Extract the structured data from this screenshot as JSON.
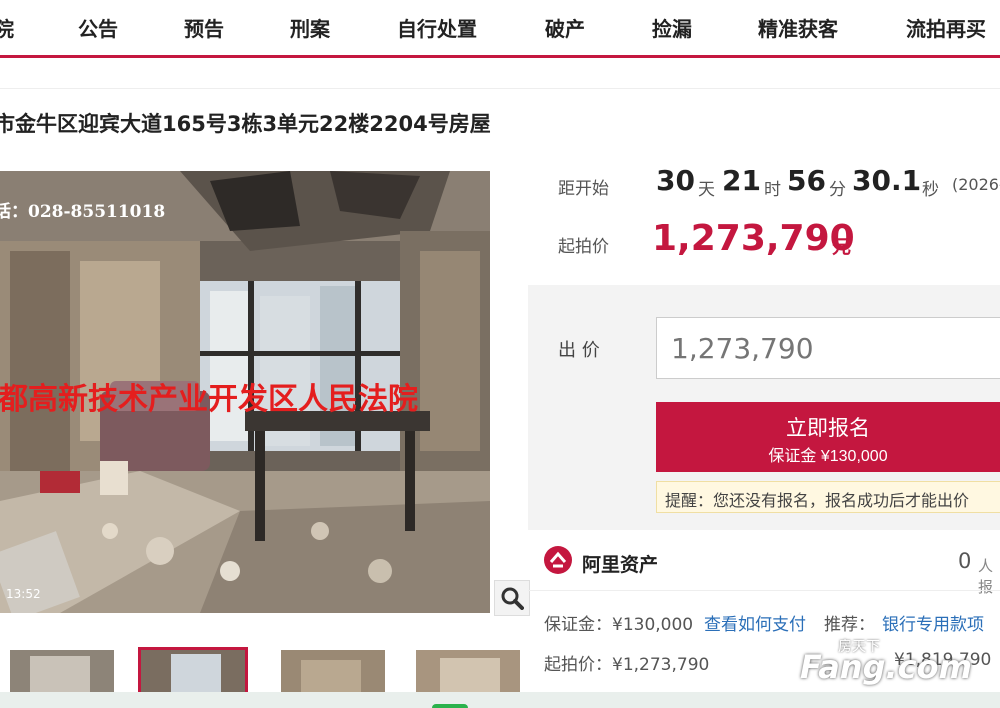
{
  "nav": {
    "items": [
      "院",
      "公告",
      "预告",
      "刑案",
      "自行处置",
      "破产",
      "捡漏",
      "精准获客",
      "流拍再买"
    ]
  },
  "title": "市金牛区迎宾大道165号3栋3单元22楼2204号房屋",
  "photo": {
    "overlay_phone": "话：028-85511018",
    "overlay_court": "都高新技术产业开发区人民法院",
    "timestamp": "13:52"
  },
  "countdown": {
    "label": "距开始",
    "days": "30",
    "days_unit": "天",
    "hours": "21",
    "hours_unit": "时",
    "minutes": "56",
    "minutes_unit": "分",
    "seconds": "30.1",
    "seconds_unit": "秒",
    "date": "(2026-"
  },
  "start_price": {
    "label": "起拍价",
    "value": "1,273,790",
    "unit": "元"
  },
  "bid": {
    "label": "出 价",
    "input_placeholder": "1,273,790",
    "signup_label": "立即报名",
    "deposit_label": "保证金 ¥130,000",
    "tip": "提醒：您还没有报名，报名成功后才能出价"
  },
  "ali": {
    "name": "阿里资产",
    "count": "0",
    "count_unit": "人报"
  },
  "info": {
    "deposit": "保证金：¥130,000",
    "how_to_pay": "查看如何支付",
    "recommend_label": "推荐：",
    "recommend_value": "银行专用款项",
    "start_price": "起拍价：¥1,273,790",
    "appraisal": "¥1,819,790"
  },
  "watermark": {
    "text_top": "房天下",
    "text_main": "Fang.com"
  },
  "colors": {
    "brand": "#c4173f",
    "link": "#2b6fb8"
  }
}
